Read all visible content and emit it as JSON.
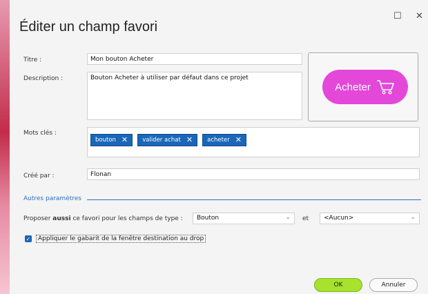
{
  "window": {
    "title": "Éditer un champ favori",
    "maximize_glyph": "☐",
    "close_glyph": "✕"
  },
  "form": {
    "title_label": "Titre :",
    "title_value": "Mon bouton Acheter",
    "description_label": "Description :",
    "description_value": "Bouton Acheter à utiliser par défaut dans ce projet",
    "keywords_label": "Mots clés :",
    "keywords": [
      "bouton",
      "valider achat",
      "acheter"
    ],
    "created_by_label": "Créé par :",
    "created_by_value": "Flonan"
  },
  "preview": {
    "button_label": "Acheter",
    "icon": "cart-icon",
    "button_color": "#e348d9"
  },
  "other_params": {
    "section_title": "Autres paramètres",
    "propose_prefix": "Proposer ",
    "propose_bold": "aussi",
    "propose_suffix": " ce favori pour les champs de type :",
    "type_value": "Bouton",
    "and_label": "et",
    "second_value": "<Aucun>",
    "apply_template_label": "Appliquer le gabarit de la fenêtre destination au drop",
    "apply_template_checked": true
  },
  "footer": {
    "ok_label": "OK",
    "cancel_label": "Annuler"
  },
  "colors": {
    "accent": "#1a67b8",
    "ok_button": "#a6e22e"
  }
}
